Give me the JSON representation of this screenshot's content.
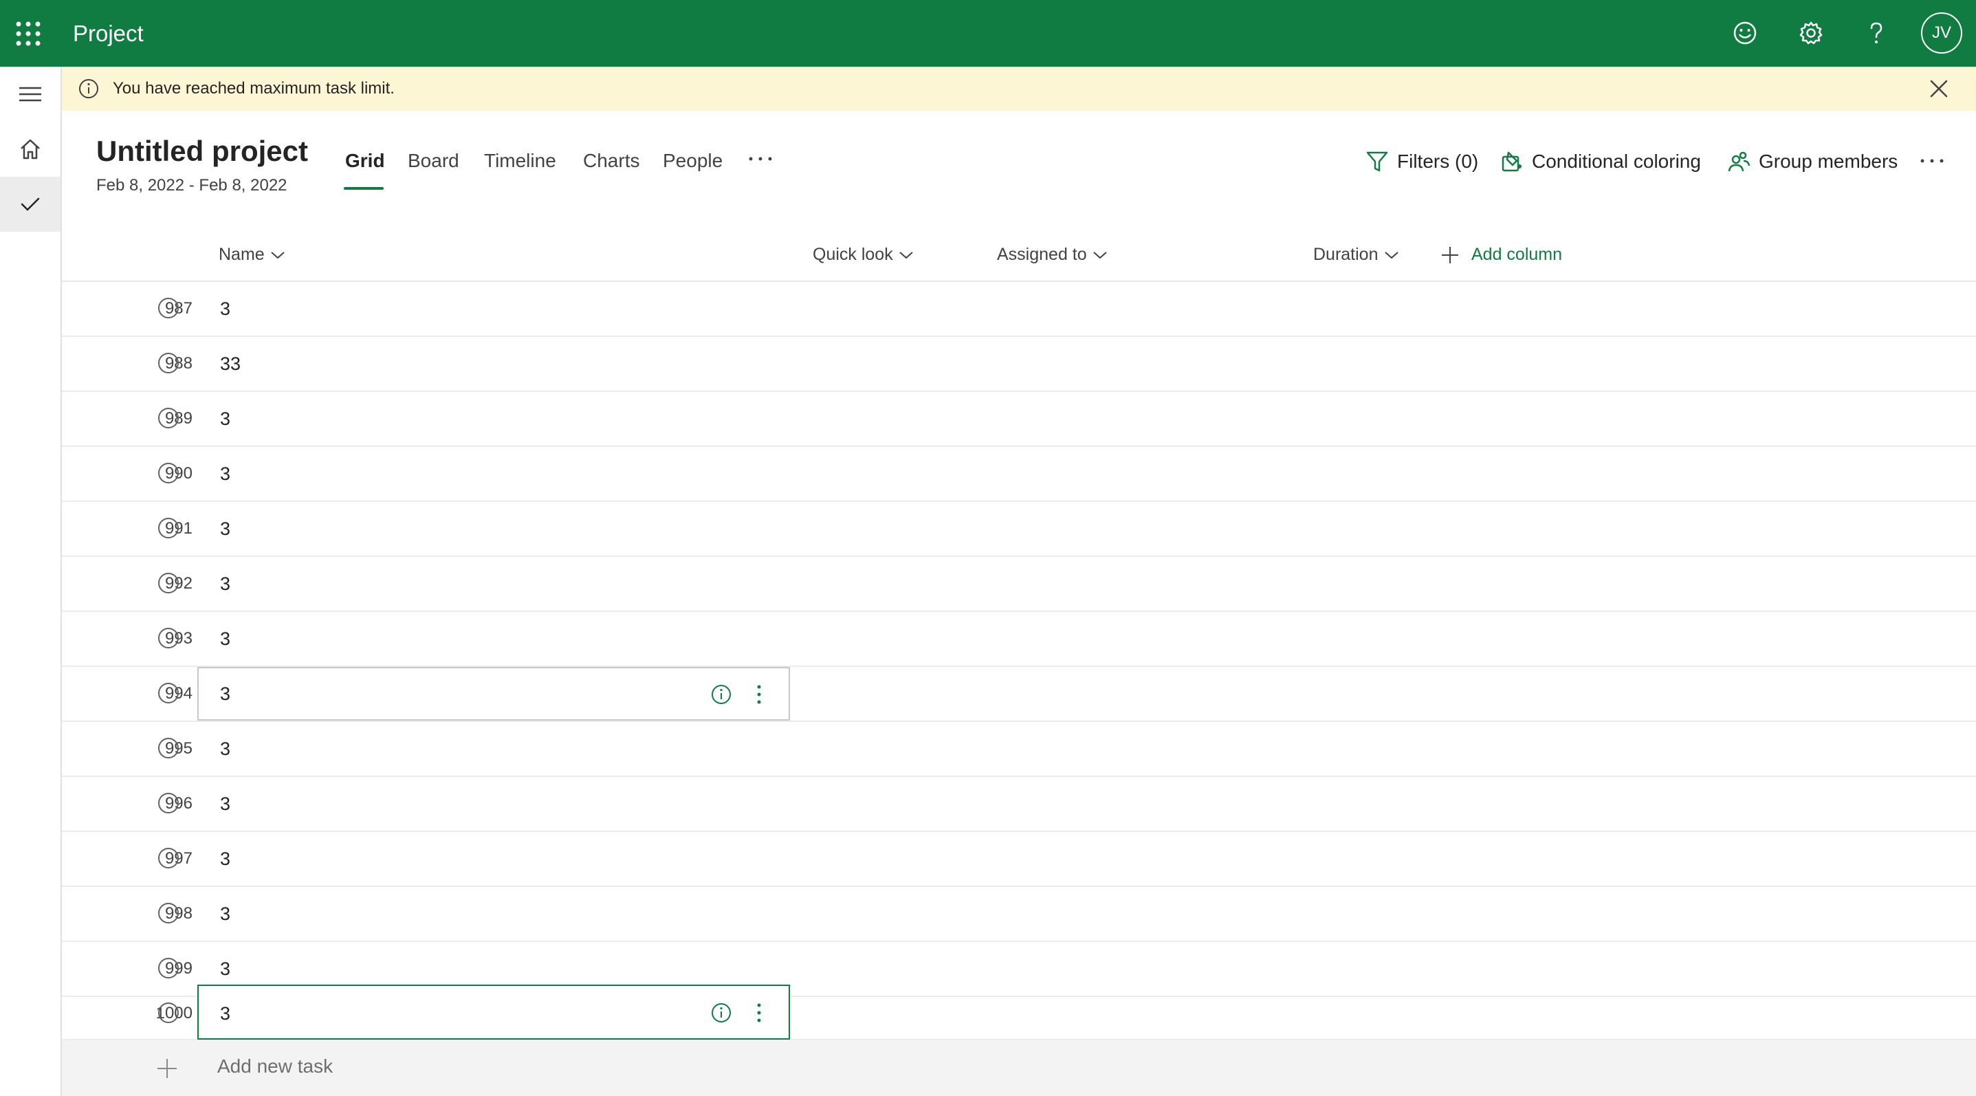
{
  "app": {
    "title": "Project",
    "user_initials": "JV"
  },
  "banner": {
    "message": "You have reached maximum task limit."
  },
  "project": {
    "title": "Untitled project",
    "dates": "Feb 8, 2022 - Feb 8, 2022"
  },
  "tabs": [
    {
      "label": "Grid",
      "active": true
    },
    {
      "label": "Board"
    },
    {
      "label": "Timeline"
    },
    {
      "label": "Charts"
    },
    {
      "label": "People"
    }
  ],
  "toolbar": {
    "filters_label": "Filters (0)",
    "conditional_label": "Conditional coloring",
    "group_label": "Group members"
  },
  "columns": {
    "name": "Name",
    "quick_look": "Quick look",
    "assigned_to": "Assigned to",
    "duration": "Duration",
    "add_column": "Add column"
  },
  "rows": [
    {
      "num": "987",
      "name": "3"
    },
    {
      "num": "988",
      "name": "33"
    },
    {
      "num": "989",
      "name": "3"
    },
    {
      "num": "990",
      "name": "3"
    },
    {
      "num": "991",
      "name": "3"
    },
    {
      "num": "992",
      "name": "3"
    },
    {
      "num": "993",
      "name": "3"
    },
    {
      "num": "994",
      "name": "3"
    },
    {
      "num": "995",
      "name": "3"
    },
    {
      "num": "996",
      "name": "3"
    },
    {
      "num": "997",
      "name": "3"
    },
    {
      "num": "998",
      "name": "3"
    },
    {
      "num": "999",
      "name": "3"
    },
    {
      "num": "1000",
      "name": "3"
    }
  ],
  "add_task": {
    "label": "Add new task"
  },
  "colors": {
    "brand": "#107c41",
    "banner_bg": "#fdf6d5"
  },
  "icons": [
    "app-launcher-icon",
    "smiley-icon",
    "gear-icon",
    "help-icon",
    "menu-icon",
    "home-icon",
    "checkmark-icon",
    "info-icon",
    "close-icon",
    "filter-icon",
    "conditional-coloring-icon",
    "group-members-icon",
    "more-icon",
    "chevron-down-icon",
    "plus-icon"
  ]
}
